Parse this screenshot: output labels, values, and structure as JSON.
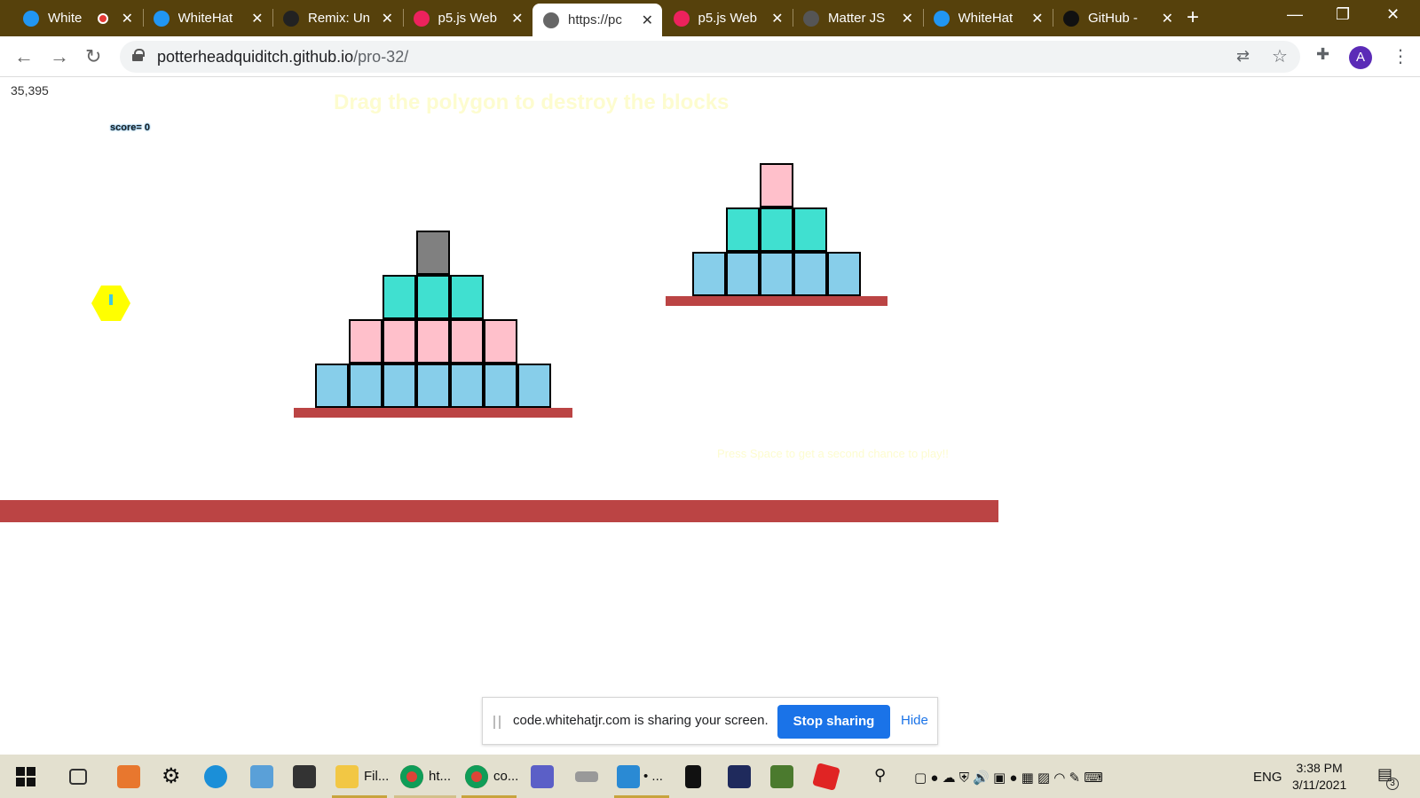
{
  "browser": {
    "tabs": [
      {
        "label": "White",
        "icon": "whitehat-icon",
        "recording": true
      },
      {
        "label": "WhiteHat",
        "icon": "whitehat-icon"
      },
      {
        "label": "Remix: Un",
        "icon": "remix-icon"
      },
      {
        "label": "p5.js Web",
        "icon": "p5-icon"
      },
      {
        "label": "https://pc",
        "icon": "globe-icon",
        "active": true
      },
      {
        "label": "p5.js Web",
        "icon": "p5-icon"
      },
      {
        "label": "Matter JS",
        "icon": "matter-icon"
      },
      {
        "label": "WhiteHat",
        "icon": "whitehat-icon"
      },
      {
        "label": "GitHub - ",
        "icon": "github-icon"
      }
    ],
    "close_glyph": "✕",
    "new_tab_glyph": "+",
    "url_host": "potterheadquiditch.github.io",
    "url_path": "/pro-32/",
    "profile_initial": "A"
  },
  "page": {
    "frame_counter": "35,395",
    "heading": "Drag the polygon to destroy the blocks",
    "score_label": "score= 0",
    "hint": "Press Space to get a second chance to play!!"
  },
  "colors": {
    "blue": "#87ceea",
    "pink": "#ffc0cb",
    "turquoise": "#40e0d0",
    "grey": "#808080",
    "ground": "#bb4444",
    "polygon": "#ffff00"
  },
  "tower1": {
    "rows": [
      {
        "color": "grey",
        "count": 1
      },
      {
        "color": "turquoise",
        "count": 3
      },
      {
        "color": "pink",
        "count": 5
      },
      {
        "color": "blue",
        "count": 7
      }
    ]
  },
  "tower2": {
    "rows": [
      {
        "color": "pink",
        "count": 1
      },
      {
        "color": "turquoise",
        "count": 3
      },
      {
        "color": "blue",
        "count": 5
      }
    ]
  },
  "share_notice": {
    "text": "code.whitehatjr.com is sharing your screen.",
    "stop_label": "Stop sharing",
    "hide_label": "Hide"
  },
  "taskbar": {
    "items": [
      {
        "label": "Fil..."
      },
      {
        "label": "ht..."
      },
      {
        "label": "co..."
      }
    ],
    "language": "ENG",
    "time": "3:38 PM",
    "date": "3/11/2021",
    "notification_count": "3"
  }
}
